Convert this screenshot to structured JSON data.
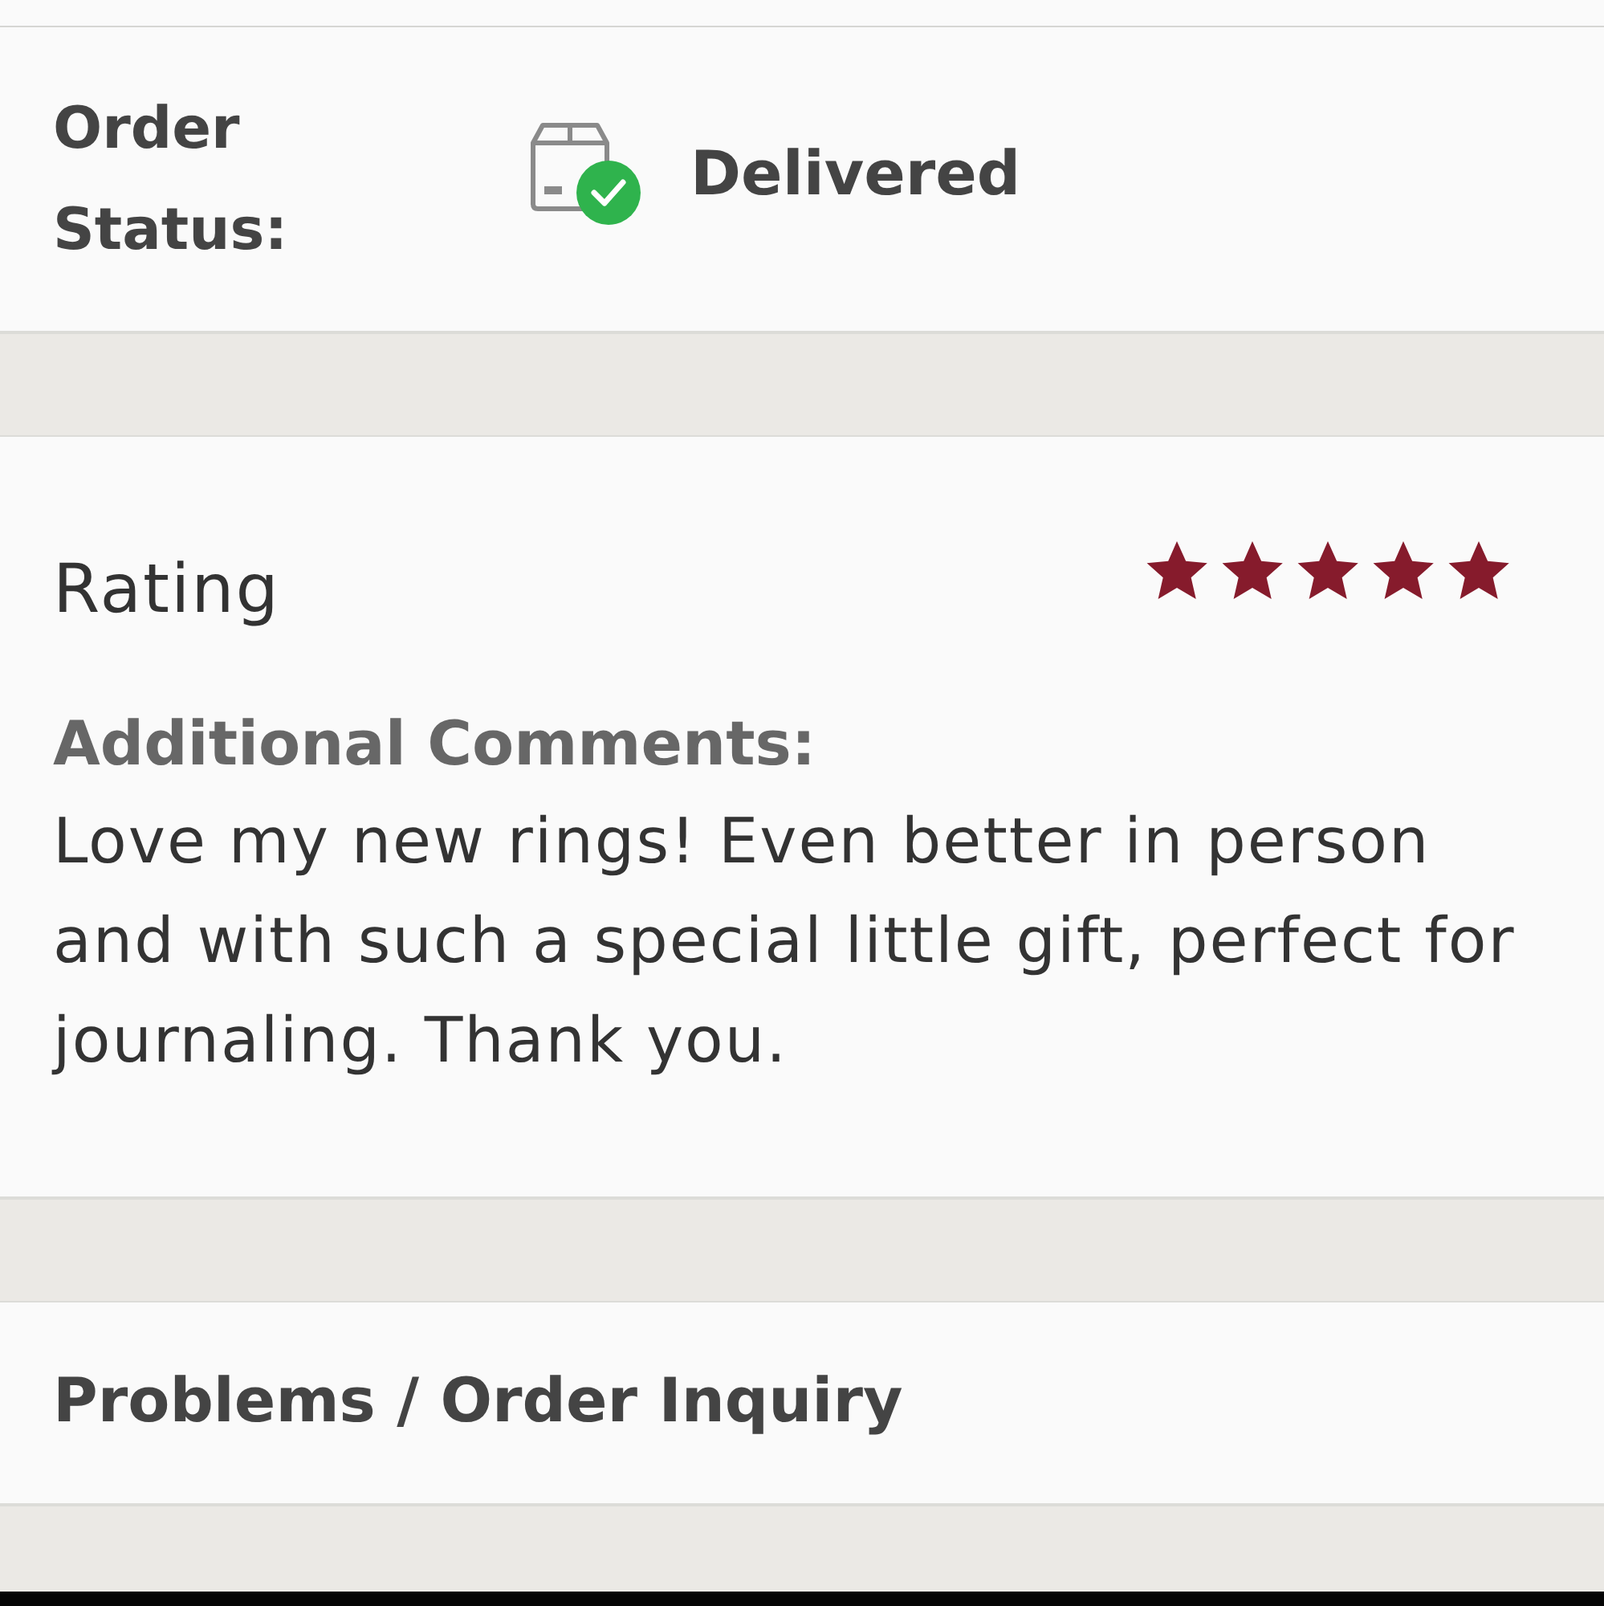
{
  "order_status": {
    "label": "Order Status:",
    "status": "Delivered"
  },
  "rating": {
    "label": "Rating",
    "stars": 5
  },
  "comments": {
    "label": "Additional Comments:",
    "text": "Love my new rings! Even better in person and with such a special little gift, perfect for journaling. Thank you."
  },
  "inquiry": {
    "label": "Problems / Order Inquiry"
  }
}
